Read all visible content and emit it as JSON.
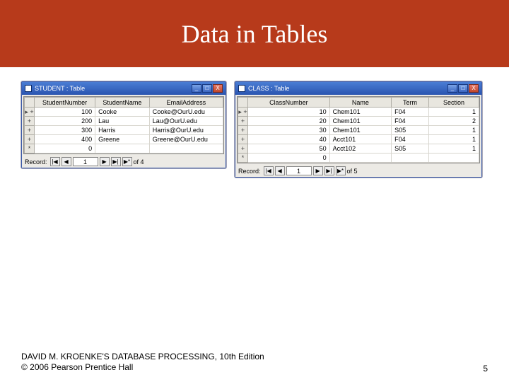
{
  "slide": {
    "title": "Data in Tables",
    "footer_book": "DAVID M. KROENKE'S DATABASE PROCESSING, 10th Edition",
    "footer_copyright": "© 2006 Pearson Prentice Hall",
    "page_number": "5"
  },
  "student_window": {
    "title": "STUDENT : Table",
    "columns": [
      "StudentNumber",
      "StudentName",
      "EmailAddress"
    ],
    "rows": [
      {
        "num": "100",
        "name": "Cooke",
        "email": "Cooke@OurU.edu"
      },
      {
        "num": "200",
        "name": "Lau",
        "email": "Lau@OurU.edu"
      },
      {
        "num": "300",
        "name": "Harris",
        "email": "Harris@OurU.edu"
      },
      {
        "num": "400",
        "name": "Greene",
        "email": "Greene@OurU.edu"
      }
    ],
    "blank_num": "0",
    "record_label": "Record:",
    "record_val": "1",
    "record_of": "of 4"
  },
  "class_window": {
    "title": "CLASS : Table",
    "columns": [
      "ClassNumber",
      "Name",
      "Term",
      "Section"
    ],
    "rows": [
      {
        "num": "10",
        "name": "Chem101",
        "term": "F04",
        "section": "1"
      },
      {
        "num": "20",
        "name": "Chem101",
        "term": "F04",
        "section": "2"
      },
      {
        "num": "30",
        "name": "Chem101",
        "term": "S05",
        "section": "1"
      },
      {
        "num": "40",
        "name": "Acct101",
        "term": "F04",
        "section": "1"
      },
      {
        "num": "50",
        "name": "Acct102",
        "term": "S05",
        "section": "1"
      }
    ],
    "blank_num": "0",
    "record_label": "Record:",
    "record_val": "1",
    "record_of": "of 5"
  },
  "winbtn": {
    "min": "_",
    "max": "□",
    "close": "X"
  },
  "nav": {
    "first": "|◀",
    "prev": "◀",
    "next": "▶",
    "last": "▶|",
    "new": "▶*"
  }
}
